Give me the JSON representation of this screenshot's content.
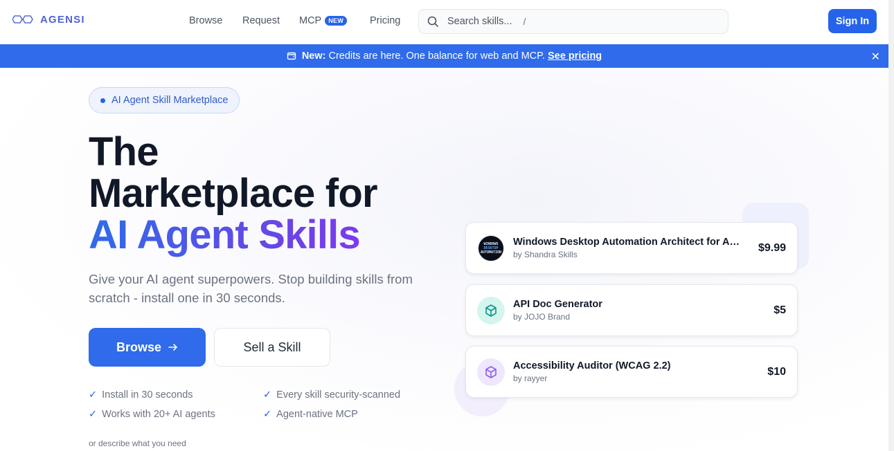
{
  "brand": {
    "name": "AGENSI"
  },
  "nav": {
    "browse": "Browse",
    "request": "Request",
    "mcp": "MCP",
    "mcp_badge": "NEW",
    "pricing": "Pricing"
  },
  "search": {
    "placeholder": "Search skills...",
    "shortcut": "/"
  },
  "signin": "Sign In",
  "banner": {
    "lead": "New:",
    "text": "Credits are here. One balance for web and MCP.",
    "link": "See pricing"
  },
  "hero": {
    "pill": "AI Agent Skill Marketplace",
    "title_line1": "The",
    "title_line2": "Marketplace for",
    "title_line3": "AI Agent Skills",
    "subtitle": "Give your AI agent superpowers. Stop building skills from scratch - install one in 30 seconds.",
    "browse_button": "Browse",
    "sell_button": "Sell a Skill",
    "features": [
      "Install in 30 seconds",
      "Every skill security-scanned",
      "Works with 20+ AI agents",
      "Agent-native MCP"
    ],
    "describe": "or describe what you need"
  },
  "thumb_text": [
    "WINDOWS",
    "DESKTOP",
    "AUTOMATION"
  ],
  "cards": [
    {
      "title": "Windows Desktop Automation Architect for AI Agents",
      "author": "by Shandra Skills",
      "price": "$9.99",
      "icon": "thumbnail-image"
    },
    {
      "title": "API Doc Generator",
      "author": "by JOJO Brand",
      "price": "$5",
      "icon": "cube-icon",
      "icon_color": "#0d9488",
      "icon_bg": "#d5f5ef"
    },
    {
      "title": "Accessibility Auditor (WCAG 2.2)",
      "author": "by rayyer",
      "price": "$10",
      "icon": "cube-icon",
      "icon_color": "#8b5cf6",
      "icon_bg": "#efe7fd"
    }
  ],
  "colors": {
    "primary": "#2563eb",
    "banner": "#2f6bea",
    "gradient_end": "#7c3aed"
  }
}
